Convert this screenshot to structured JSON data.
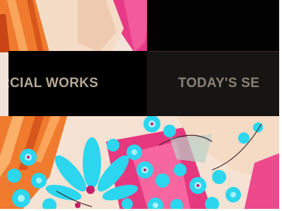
{
  "navigation": {
    "items": [
      {
        "label": "RCIAL WORKS"
      },
      {
        "label": "TODAY'S SE"
      }
    ]
  },
  "theme": {
    "band_background": "#000000",
    "nav_text_color": "#b4a794",
    "accent_cyan": "#2bd6ee",
    "accent_pink": "#ea3f8c",
    "accent_orange": "#f0782c",
    "skin_tone": "#f4d8c0"
  }
}
